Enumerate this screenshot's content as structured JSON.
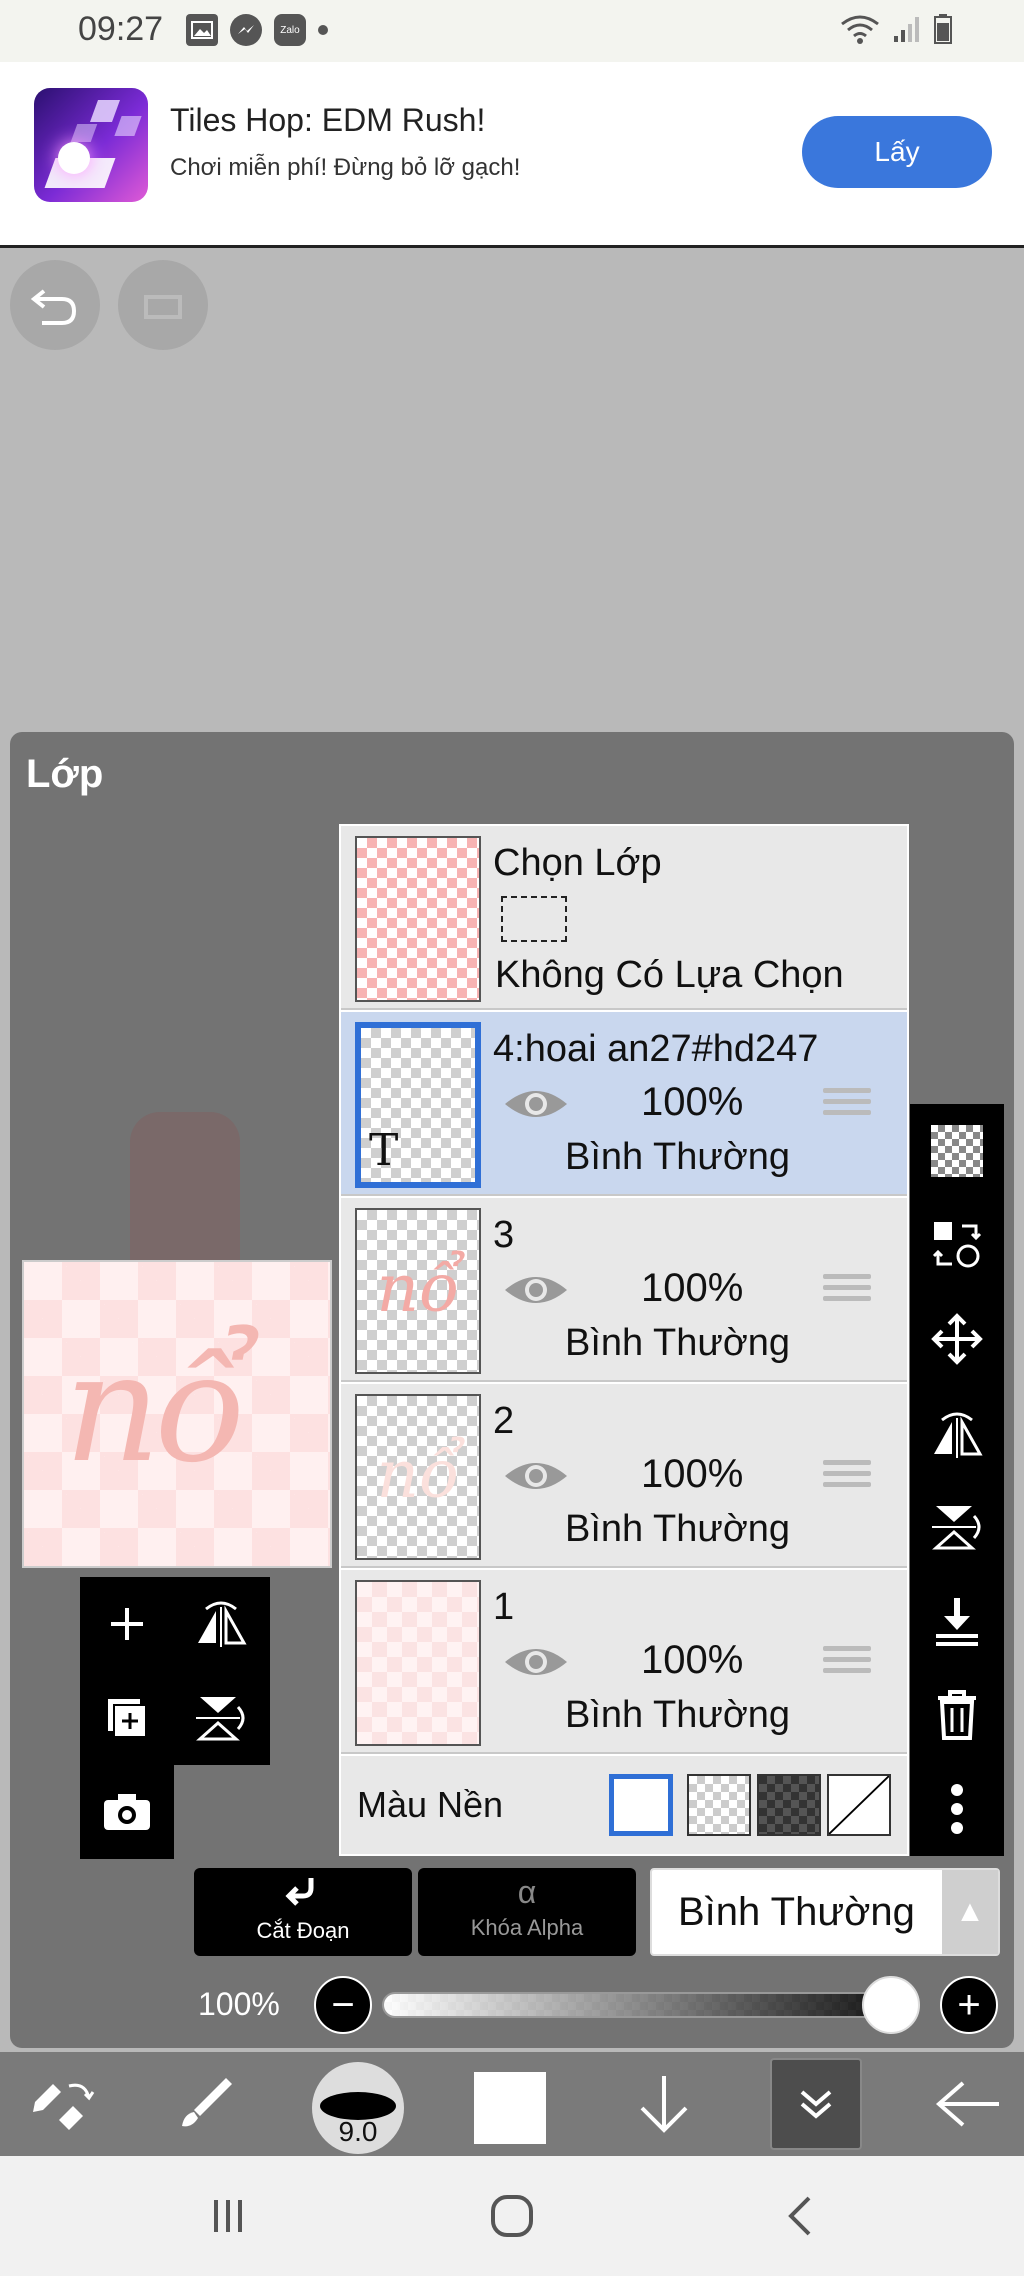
{
  "status_bar": {
    "time": "09:27",
    "icons": [
      "gallery-icon",
      "messenger-icon",
      "zalo-icon",
      "dot-icon",
      "wifi-icon",
      "signal-icon",
      "battery-icon"
    ],
    "zalo_label": "Zalo"
  },
  "ad": {
    "title": "Tiles Hop: EDM Rush!",
    "subtitle": "Chơi miễn phí! Đừng bỏ lỡ gạch!",
    "button": "Lấy",
    "button_color": "#3a77dc"
  },
  "panel": {
    "title": "Lớp"
  },
  "layers": [
    {
      "kind": "selection",
      "name": "Chọn Lớp",
      "subtitle": "Không Có Lựa Chọn"
    },
    {
      "kind": "layer",
      "name": "4:hoai an27#hd247",
      "opacity": "100%",
      "mode": "Bình Thường",
      "selected": true,
      "thumb_glyph": "T"
    },
    {
      "kind": "layer",
      "name": "3",
      "opacity": "100%",
      "mode": "Bình Thường",
      "selected": false,
      "thumb_art": "nổ"
    },
    {
      "kind": "layer",
      "name": "2",
      "opacity": "100%",
      "mode": "Bình Thường",
      "selected": false,
      "thumb_art": "nổ"
    },
    {
      "kind": "layer",
      "name": "1",
      "opacity": "100%",
      "mode": "Bình Thường",
      "selected": false
    }
  ],
  "background": {
    "label": "Màu Nền",
    "selected_swatch": "white"
  },
  "preview": {
    "art_text": "nổ"
  },
  "controls": {
    "clip_label": "Cắt Đoạn",
    "alpha_lock_label": "Khóa Alpha",
    "alpha_glyph": "α",
    "blend_mode": "Bình Thường",
    "opacity_label": "100%",
    "opacity_value": 1.0,
    "minus": "−",
    "plus": "+"
  },
  "toolbar": {
    "brush_size": "9.0",
    "primary_color": "#ffffff"
  },
  "colors": {
    "selection_accent": "#2f6fd6",
    "selected_row": "#c9d7ee",
    "panel_bg": "#737373"
  }
}
